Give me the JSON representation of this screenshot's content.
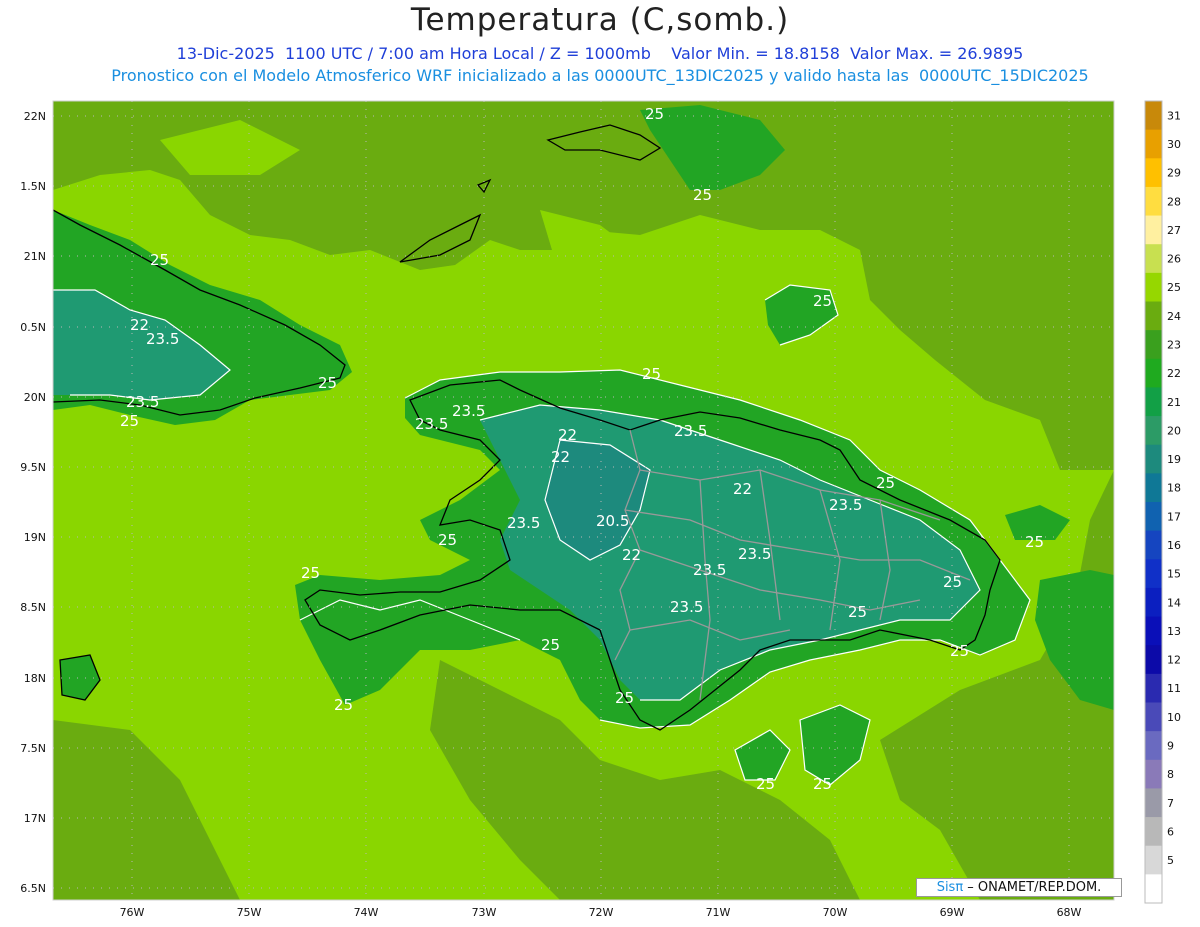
{
  "header": {
    "title": "Temperatura (C,somb.)",
    "line1": "13-Dic-2025  1100 UTC / 7:00 am Hora Local / Z = 1000mb    Valor Min. = 18.8158  Valor Max. = 26.9895",
    "line2": "Pronostico con el Modelo Atmosferico WRF inicializado a las 0000UTC_13DIC2025 y valido hasta las  0000UTC_15DIC2025"
  },
  "axes": {
    "lat_labels": [
      "22N",
      "1.5N",
      "21N",
      "0.5N",
      "20N",
      "9.5N",
      "19N",
      "8.5N",
      "18N",
      "7.5N",
      "17N",
      "6.5N"
    ],
    "lon_labels": [
      "76W",
      "75W",
      "74W",
      "73W",
      "72W",
      "71W",
      "70W",
      "69W",
      "68W"
    ]
  },
  "contour_labels": [
    "25",
    "25",
    "25",
    "22",
    "23.5",
    "25",
    "23.5",
    "25",
    "25",
    "25",
    "23.5",
    "22",
    "22",
    "23.5",
    "22",
    "25",
    "23.5",
    "20.5",
    "22",
    "23.5",
    "23.5",
    "23.5",
    "25",
    "23.5",
    "25",
    "25",
    "25",
    "23.5",
    "25",
    "25",
    "25",
    "25",
    "25",
    "25",
    "25"
  ],
  "colorbar": {
    "ticks": [
      "31",
      "30",
      "29",
      "28",
      "27",
      "26",
      "25",
      "24",
      "23",
      "22",
      "21",
      "20",
      "19",
      "18",
      "17",
      "16",
      "15",
      "14",
      "13",
      "12",
      "11",
      "10",
      "9",
      "8",
      "7",
      "6",
      "5"
    ],
    "colors": [
      "#c8890a",
      "#e8a000",
      "#ffc000",
      "#ffdd40",
      "#fff0a0",
      "#c8e050",
      "#96d700",
      "#6aac10",
      "#3aa01e",
      "#1faa1f",
      "#12a046",
      "#2c9b66",
      "#1d8a7d",
      "#0f7896",
      "#1062b0",
      "#1545c0",
      "#1030c8",
      "#0b1fc0",
      "#0a0fb8",
      "#0c0aa8",
      "#2a2ab0",
      "#4a4ab8",
      "#6a6ac0",
      "#8a7ab8",
      "#9a9aa8",
      "#b8b8b8",
      "#d8d8d8",
      "#ffffff"
    ]
  },
  "footer": {
    "brand": "Sisπ",
    "text": " – ONAMET/REP.DOM."
  },
  "map_colors": {
    "sea_warm": "#8ad600",
    "sea_mid": "#6aac10",
    "land_green": "#22a524",
    "land_teal": "#1f9a72",
    "contour": "#ffffff",
    "coast": "#000000",
    "border": "#999999"
  }
}
